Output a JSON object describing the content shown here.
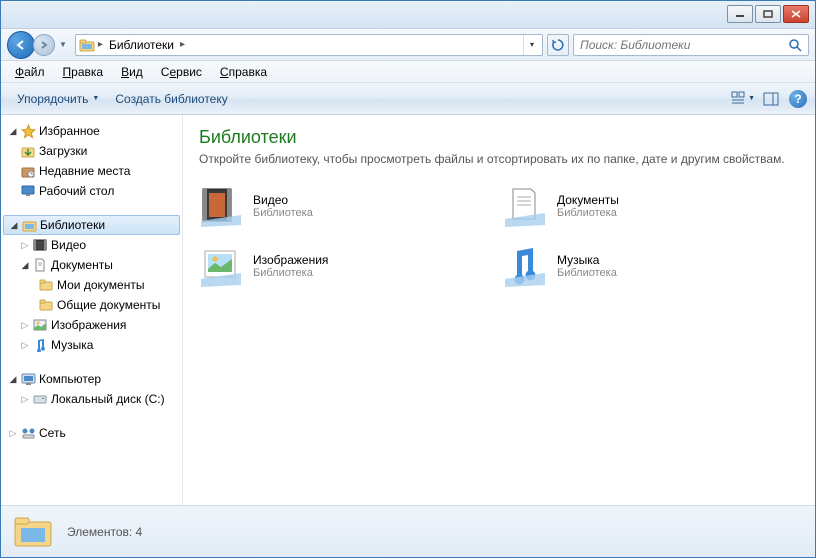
{
  "titlebar": {},
  "nav": {
    "path_root": "Библиотеки",
    "search_placeholder": "Поиск: Библиотеки"
  },
  "menu": {
    "file": "Файл",
    "edit": "Правка",
    "view": "Вид",
    "tools": "Сервис",
    "help": "Справка"
  },
  "toolbar": {
    "organize": "Упорядочить",
    "new_library": "Создать библиотеку"
  },
  "sidebar": {
    "favorites": {
      "label": "Избранное"
    },
    "favorites_items": {
      "downloads": "Загрузки",
      "recent": "Недавние места",
      "desktop": "Рабочий стол"
    },
    "libraries": {
      "label": "Библиотеки"
    },
    "libraries_items": {
      "videos": "Видео",
      "documents": "Документы",
      "my_documents": "Мои документы",
      "public_documents": "Общие документы",
      "pictures": "Изображения",
      "music": "Музыка"
    },
    "computer": {
      "label": "Компьютер"
    },
    "computer_items": {
      "local_disk": "Локальный диск (C:)"
    },
    "network": {
      "label": "Сеть"
    }
  },
  "content": {
    "title": "Библиотеки",
    "subtitle": "Откройте библиотеку, чтобы просмотреть файлы и отсортировать их по папке, дате и другим свойствам.",
    "items": {
      "videos": {
        "name": "Видео",
        "type": "Библиотека"
      },
      "documents": {
        "name": "Документы",
        "type": "Библиотека"
      },
      "pictures": {
        "name": "Изображения",
        "type": "Библиотека"
      },
      "music": {
        "name": "Музыка",
        "type": "Библиотека"
      }
    }
  },
  "statusbar": {
    "count_label": "Элементов: 4"
  }
}
